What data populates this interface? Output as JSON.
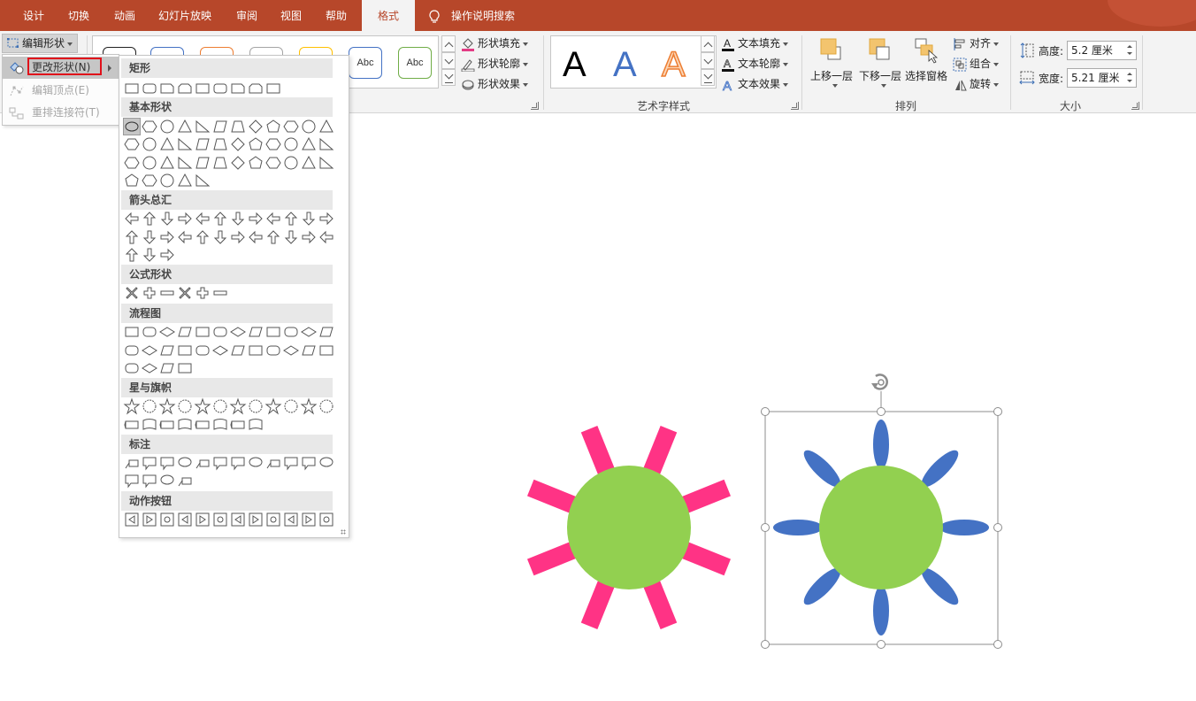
{
  "tabs": [
    {
      "label": "设计",
      "active": false
    },
    {
      "label": "切换",
      "active": false
    },
    {
      "label": "动画",
      "active": false
    },
    {
      "label": "幻灯片放映",
      "active": false
    },
    {
      "label": "审阅",
      "active": false
    },
    {
      "label": "视图",
      "active": false
    },
    {
      "label": "帮助",
      "active": false
    },
    {
      "label": "格式",
      "active": true
    }
  ],
  "tell_me": {
    "label": "操作说明搜索",
    "icon": "lightbulb-icon"
  },
  "ribbon": {
    "edit_shape_label": "编辑形状",
    "shape_styles": {
      "swatch_text": "Abc",
      "fill_label": "形状填充",
      "outline_label": "形状轮廓",
      "effects_label": "形状效果",
      "fill_color": "#e33c84"
    },
    "wordart": {
      "group_label": "艺术字样式",
      "letter": "A",
      "text_fill_label": "文本填充",
      "text_outline_label": "文本轮廓",
      "text_effects_label": "文本效果"
    },
    "arrange": {
      "group_label": "排列",
      "bring_forward_label": "上移一层",
      "send_backward_label": "下移一层",
      "selection_pane_label": "选择窗格",
      "align_label": "对齐",
      "group_btn_label": "组合",
      "rotate_label": "旋转"
    },
    "size": {
      "group_label": "大小",
      "height_label": "高度:",
      "height_value": "5.2 厘米",
      "width_label": "宽度:",
      "width_value": "5.21 厘米"
    }
  },
  "edit_menu": {
    "items": [
      {
        "label": "更改形状(N)",
        "enabled": true,
        "highlighted": true
      },
      {
        "label": "编辑顶点(E)",
        "enabled": false
      },
      {
        "label": "重排连接符(T)",
        "enabled": false
      }
    ]
  },
  "shape_gallery": {
    "categories": [
      {
        "label": "矩形"
      },
      {
        "label": "基本形状"
      },
      {
        "label": "箭头总汇"
      },
      {
        "label": "公式形状"
      },
      {
        "label": "流程图"
      },
      {
        "label": "星与旗帜"
      },
      {
        "label": "标注"
      },
      {
        "label": "动作按钮"
      }
    ]
  },
  "canvas": {
    "center_color": "#92d050",
    "ray_color": "#ff3385",
    "petal_color": "#4472c4"
  }
}
